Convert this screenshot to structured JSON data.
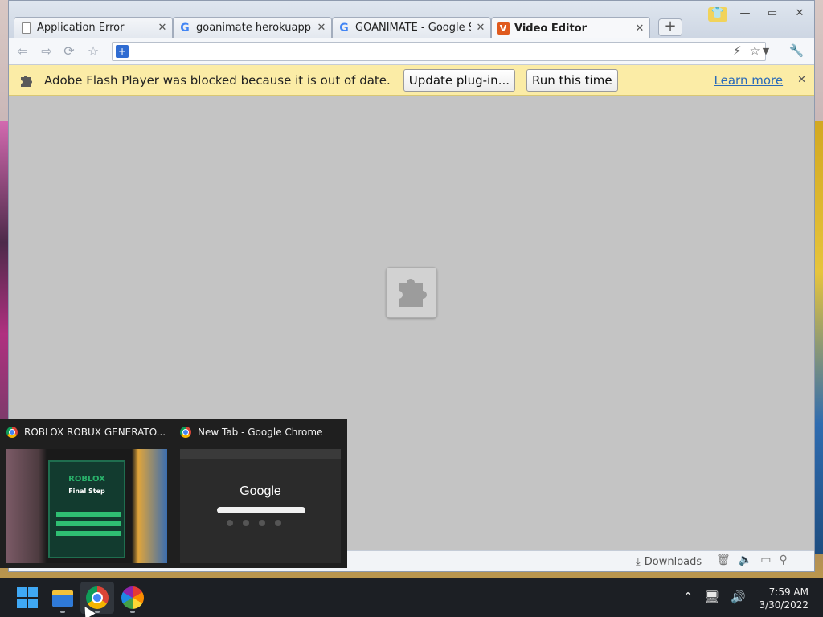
{
  "browser": {
    "tabs": [
      {
        "title": "Application Error",
        "favicon": "page-icon",
        "active": false
      },
      {
        "title": "goanimate herokuapp - G",
        "favicon": "google-icon",
        "active": false
      },
      {
        "title": "GOANIMATE - Google Sea",
        "favicon": "google-icon",
        "active": false
      },
      {
        "title": "Video Editor",
        "favicon": "vyond-icon",
        "active": true
      }
    ],
    "tab_close_glyph": "✕",
    "new_tab_glyph": "+",
    "window_controls": {
      "minimize": "—",
      "restore": "▭",
      "close": "✕"
    },
    "omnibox": {
      "value": "",
      "placeholder": ""
    },
    "infobar": {
      "message": "Adobe Flash Player was blocked because it is out of date.",
      "update_button": "Update plug-in...",
      "run_button": "Run this time",
      "learn_more": "Learn more",
      "close_glyph": "✕"
    },
    "status": {
      "downloads": "Downloads"
    }
  },
  "preview": {
    "items": [
      {
        "title": "ROBLOX ROBUX GENERATO...",
        "thumb_logo": "ROBLOX",
        "thumb_heading": "Final Step"
      },
      {
        "title": "New Tab - Google Chrome",
        "thumb_logo": "Google"
      }
    ]
  },
  "taskbar": {
    "time": "7:59 AM",
    "date": "3/30/2022"
  },
  "colors": {
    "infobar_bg": "#fbeca6",
    "content_bg": "#c4c4c4",
    "taskbar_bg": "#1c1f24",
    "link": "#2a6ab8"
  }
}
